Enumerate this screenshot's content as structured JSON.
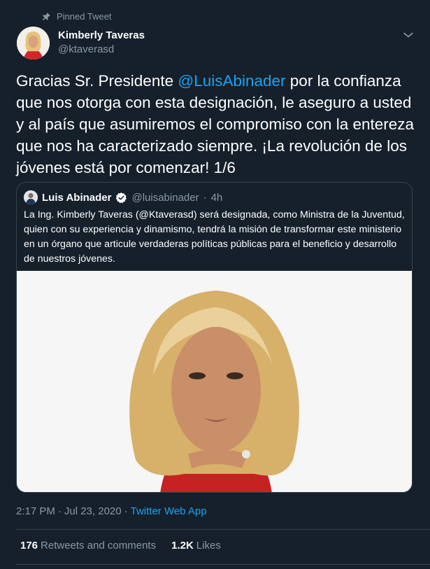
{
  "pinned": {
    "label": "Pinned Tweet",
    "icon": "pin-icon"
  },
  "author": {
    "name": "Kimberly Taveras",
    "handle": "@ktaverasd"
  },
  "tweet": {
    "prefix": "Gracias Sr. Presidente ",
    "mention": "@LuisAbinader",
    "suffix": " por la confianza que nos otorga con esta designación, le aseguro a usted y al país que asumiremos el compromiso con la entereza que nos ha caracterizado siempre. ¡La revolución de los jóvenes está por comenzar! 1/6"
  },
  "quoted": {
    "name": "Luis Abinader",
    "handle": "@luisabinader",
    "time": "4h",
    "separator": "·",
    "text": "La Ing. Kimberly Taveras (@Ktaverasd) será designada, como Ministra de la Juventud, quien con su experiencia y dinamismo, tendrá la misión de transformar este ministerio en un órgano que articule verdaderas políticas públicas para el beneficio y desarrollo de nuestros jóvenes."
  },
  "meta": {
    "time": "2:17 PM",
    "date": "Jul 23, 2020",
    "separator": "·",
    "source": "Twitter Web App"
  },
  "stats": {
    "retweets_count": "176",
    "retweets_label": "Retweets and comments",
    "likes_count": "1.2K",
    "likes_label": "Likes"
  },
  "colors": {
    "background": "#15202b",
    "text": "#ffffff",
    "secondary": "#8899a6",
    "accent": "#1da1f2",
    "border": "#38444d"
  }
}
